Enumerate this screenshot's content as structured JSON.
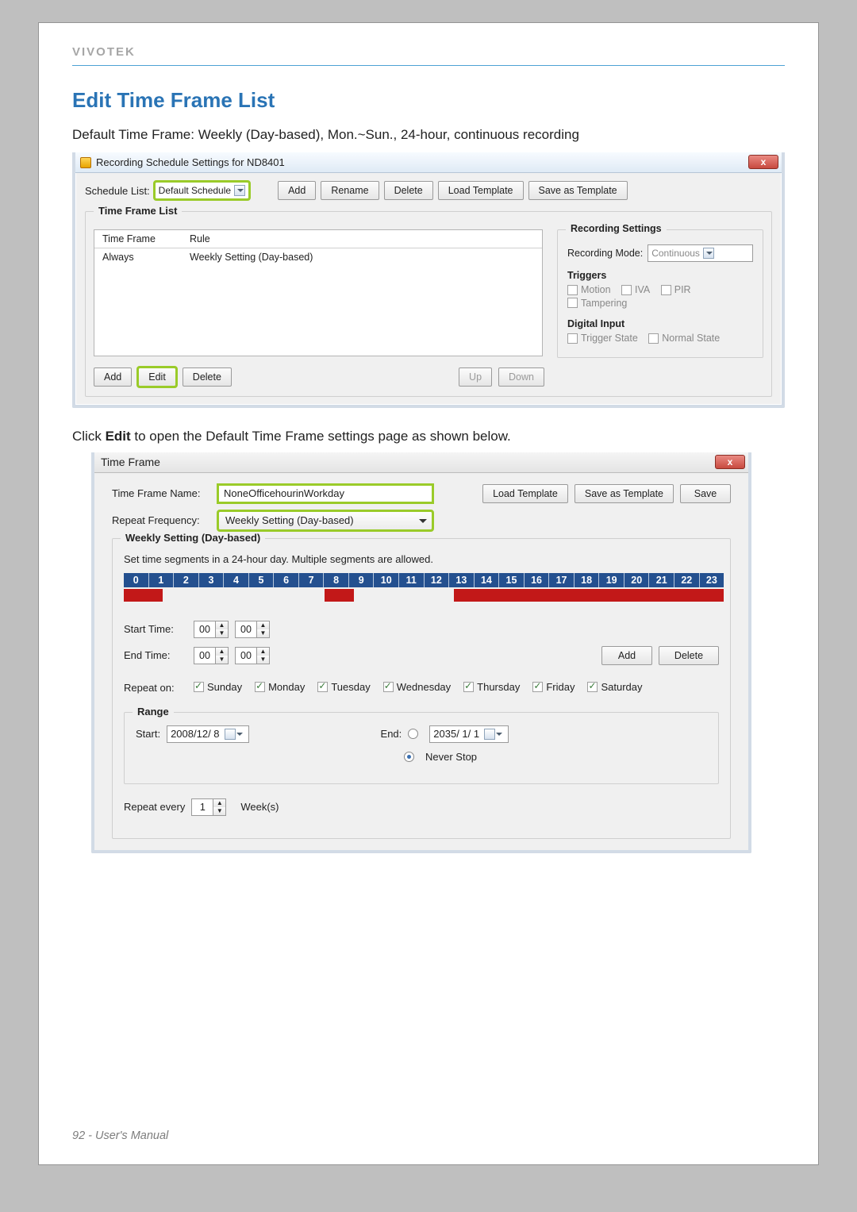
{
  "brand": "VIVOTEK",
  "page_number": "92",
  "footer_suffix": " - User's Manual",
  "heading": "Edit Time Frame List",
  "intro": "Default Time Frame: Weekly (Day-based), Mon.~Sun., 24-hour, continuous recording",
  "desc2_pre": "Click ",
  "desc2_bold": "Edit",
  "desc2_post": " to open the Default Time Frame settings page as shown below.",
  "win1": {
    "title": "Recording Schedule Settings for ND8401",
    "close_glyph": "x",
    "schedule_list_label": "Schedule List:",
    "schedule_list_value": "Default Schedule",
    "buttons": {
      "add": "Add",
      "rename": "Rename",
      "delete": "Delete",
      "load": "Load Template",
      "save": "Save as Template"
    },
    "tfl": {
      "legend": "Time Frame List",
      "head_tf": "Time Frame",
      "head_rule": "Rule",
      "row_tf": "Always",
      "row_rule": "Weekly Setting (Day-based)"
    },
    "rec": {
      "legend": "Recording Settings",
      "mode_label": "Recording Mode:",
      "mode_value": "Continuous",
      "triggers_head": "Triggers",
      "t_motion": "Motion",
      "t_iva": "IVA",
      "t_pir": "PIR",
      "t_tamp": "Tampering",
      "di_head": "Digital Input",
      "di_trig": "Trigger State",
      "di_norm": "Normal State"
    },
    "bottom": {
      "add": "Add",
      "edit": "Edit",
      "delete": "Delete",
      "up": "Up",
      "down": "Down"
    }
  },
  "win2": {
    "title": "Time Frame",
    "close_glyph": "x",
    "name_label": "Time Frame Name:",
    "name_value": "NoneOfficehourinWorkday",
    "freq_label": "Repeat Frequency:",
    "freq_value": "Weekly Setting (Day-based)",
    "load": "Load Template",
    "save_tpl": "Save as Template",
    "save": "Save",
    "weekly_legend": "Weekly Setting (Day-based)",
    "hint": "Set time segments in a 24-hour day. Multiple segments are allowed.",
    "hours": [
      "0",
      "1",
      "2",
      "3",
      "4",
      "5",
      "6",
      "7",
      "8",
      "9",
      "10",
      "11",
      "12",
      "13",
      "14",
      "15",
      "16",
      "17",
      "18",
      "19",
      "20",
      "21",
      "22",
      "23"
    ],
    "segments": [
      {
        "type": "seg",
        "w": 6.5
      },
      {
        "type": "gap",
        "w": 27.0
      },
      {
        "type": "seg",
        "w": 4.8
      },
      {
        "type": "gap",
        "w": 16.7
      },
      {
        "type": "seg",
        "w": 45.0
      }
    ],
    "start_label": "Start Time:",
    "end_label": "End Time:",
    "spin_h": "00",
    "spin_m": "00",
    "add": "Add",
    "delete": "Delete",
    "repeat_on": "Repeat on:",
    "days": [
      "Sunday",
      "Monday",
      "Tuesday",
      "Wednesday",
      "Thursday",
      "Friday",
      "Saturday"
    ],
    "range_legend": "Range",
    "start_text": "Start:",
    "start_date": "2008/12/ 8",
    "end_text": "End:",
    "end_date": "2035/ 1/ 1",
    "never": "Never Stop",
    "repeat_every": "Repeat every",
    "repeat_n": "1",
    "weeks": "Week(s)"
  }
}
